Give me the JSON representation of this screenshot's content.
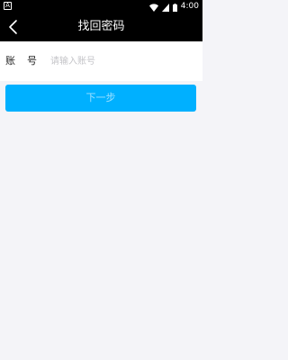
{
  "status_bar": {
    "left_icon_letter": "A",
    "time": "4:00",
    "icons": [
      "wifi-icon",
      "cell-signal-icon",
      "battery-icon"
    ]
  },
  "header": {
    "back_icon": "chevron-left-icon",
    "title": "找回密码"
  },
  "form": {
    "account_label": "账号",
    "account_placeholder": "请输入账号",
    "account_value": ""
  },
  "actions": {
    "next_label": "下一步"
  },
  "colors": {
    "header_bg": "#000000",
    "page_bg": "#f4f4f8",
    "button_bg": "#00b0ff",
    "button_text": "#9fe0ff",
    "placeholder": "#c4c4c8"
  }
}
